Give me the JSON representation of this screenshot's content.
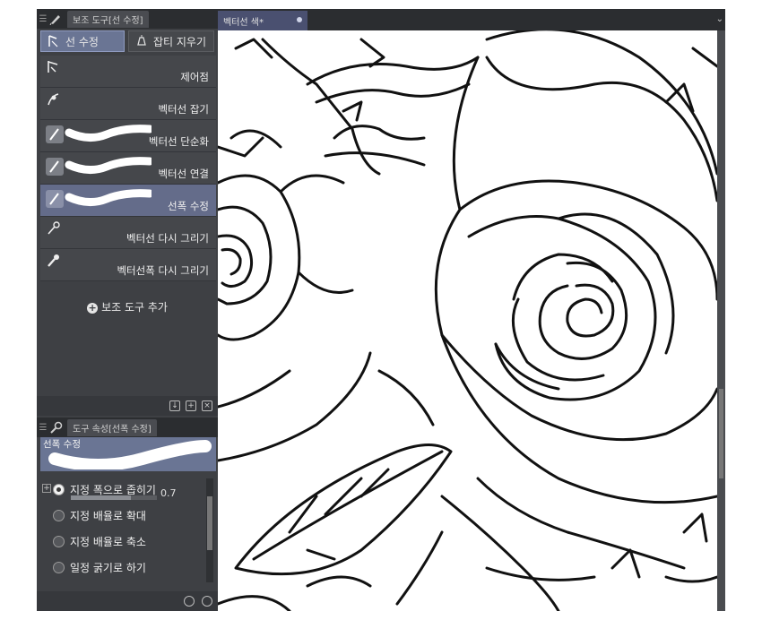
{
  "subtool_panel": {
    "title": "보조 도구[선 수정]"
  },
  "tool_groups": [
    {
      "label": "선 수정",
      "active": true
    },
    {
      "label": "잡티 지우기",
      "active": false
    }
  ],
  "subtools": [
    {
      "label": "제어점",
      "icon": "control-point-icon",
      "selected": false
    },
    {
      "label": "벡터선 잡기",
      "icon": "vector-grab-icon",
      "selected": false
    },
    {
      "label": "벡터선 단순화",
      "icon": "brush-stroke-icon",
      "selected": false
    },
    {
      "label": "벡터선 연결",
      "icon": "brush-stroke-icon",
      "selected": false
    },
    {
      "label": "선폭 수정",
      "icon": "brush-stroke-icon",
      "selected": true
    },
    {
      "label": "벡터선 다시 그리기",
      "icon": "redraw-icon",
      "selected": false
    },
    {
      "label": "벡터선폭 다시 그리기",
      "icon": "redraw-width-icon",
      "selected": false
    }
  ],
  "add_subtool_label": "보조 도구 추가",
  "property_panel": {
    "title": "도구 속성[선폭 수정]",
    "preview_label": "선폭 수정",
    "options": [
      {
        "label": "지정 폭으로 좁히기",
        "selected": true
      },
      {
        "label": "지정 배율로 확대",
        "selected": false
      },
      {
        "label": "지정 배율로 축소",
        "selected": false
      },
      {
        "label": "일정 굵기로 하기",
        "selected": false
      }
    ],
    "width_value": "0.7"
  },
  "document": {
    "tab_title": "벡터선 색*"
  },
  "colors": {
    "accent": "#6a7594",
    "panel": "#3e4044",
    "header": "#2b2d30"
  }
}
